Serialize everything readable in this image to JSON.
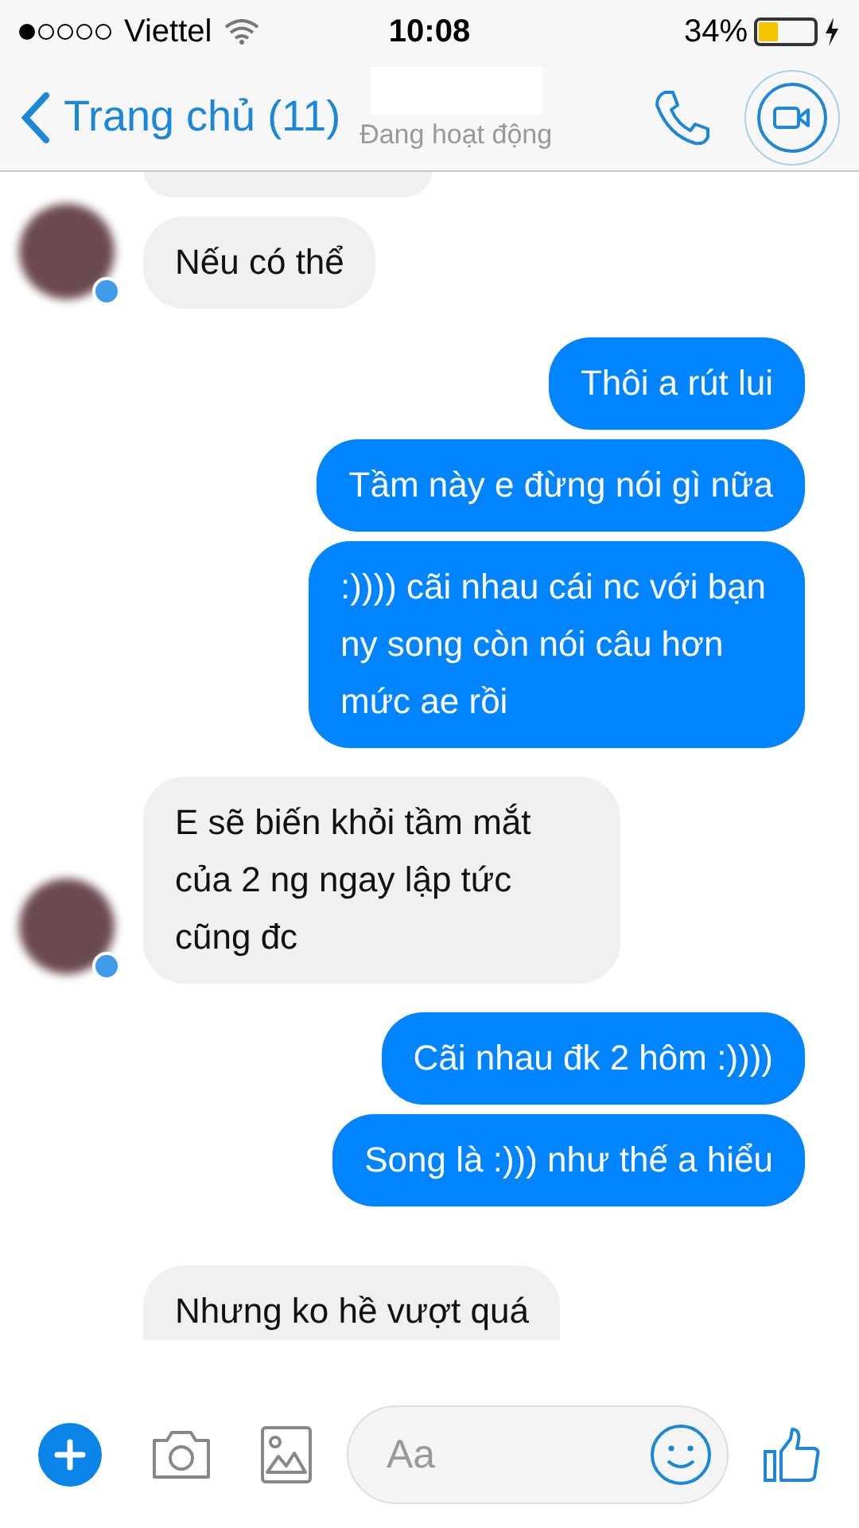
{
  "status_bar": {
    "carrier": "Viettel",
    "time": "10:08",
    "battery": "34%"
  },
  "header": {
    "back_label": "Trang chủ (11)",
    "presence": "Đang hoạt động"
  },
  "messages": [
    {
      "kind": "received",
      "text": "Nếu có thể",
      "avatar": true
    },
    {
      "kind": "sent",
      "text": "Thôi a rút lui"
    },
    {
      "kind": "sent",
      "text": "Tầm này e đừng nói gì nữa"
    },
    {
      "kind": "sent",
      "text": ":)))) cãi nhau cái nc với bạn ny song còn nói câu hơn mức ae rồi"
    },
    {
      "kind": "received",
      "text": "E sẽ biến khỏi tầm mắt của 2 ng ngay lập tức cũng đc",
      "avatar": true
    },
    {
      "kind": "sent",
      "text": "Cãi nhau đk 2 hôm :))))"
    },
    {
      "kind": "sent",
      "text": "Song là :))) như thế a hiểu"
    },
    {
      "kind": "received",
      "text": "Nhưng ko hề vượt quá",
      "avatar": false
    }
  ],
  "composer": {
    "placeholder": "Aa"
  }
}
